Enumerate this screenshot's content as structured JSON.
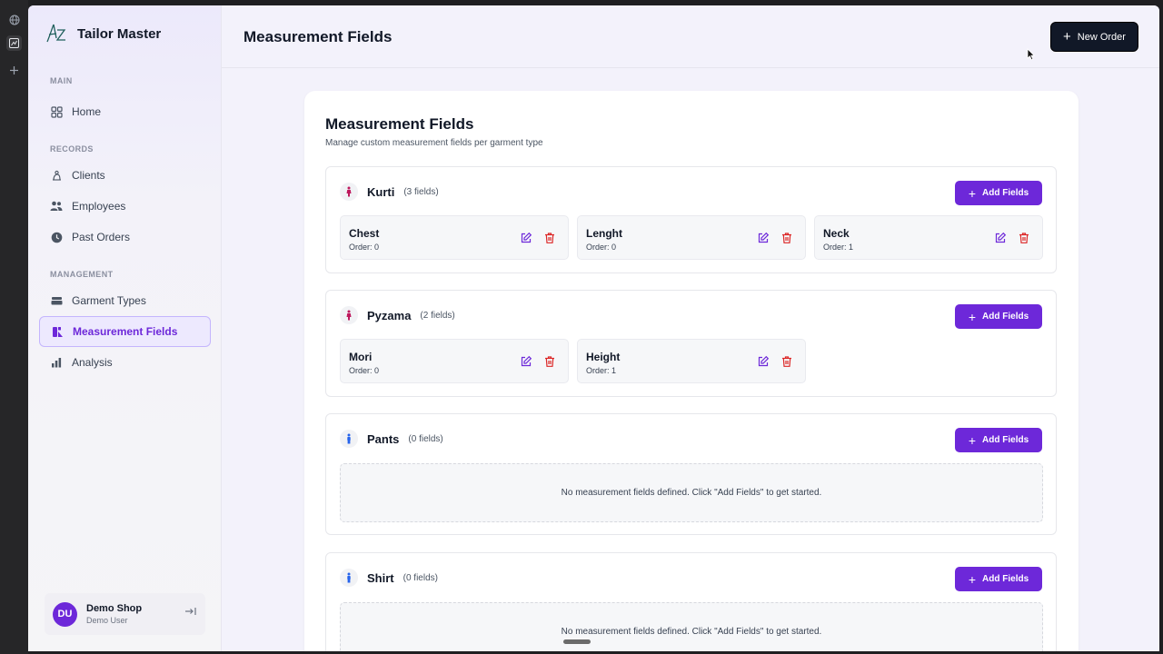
{
  "app": {
    "brand_name": "Tailor Master",
    "page_title": "Measurement Fields",
    "new_order_label": "New Order"
  },
  "sidebar": {
    "sections": {
      "main": "MAIN",
      "records": "RECORDS",
      "management": "MANAGEMENT"
    },
    "items": [
      {
        "label": "Home",
        "icon": "grid-icon"
      },
      {
        "label": "Clients",
        "icon": "scissors-icon"
      },
      {
        "label": "Employees",
        "icon": "users-icon"
      },
      {
        "label": "Past Orders",
        "icon": "clock-icon"
      },
      {
        "label": "Garment Types",
        "icon": "layers-icon"
      },
      {
        "label": "Measurement Fields",
        "icon": "ruler-icon",
        "active": true
      },
      {
        "label": "Analysis",
        "icon": "bar-chart-icon"
      }
    ],
    "user": {
      "initials": "DU",
      "name": "Demo Shop",
      "role": "Demo User"
    }
  },
  "main": {
    "title": "Measurement Fields",
    "subtitle": "Manage custom measurement fields per garment type",
    "add_label": "Add Fields",
    "empty_message": "No measurement fields defined. Click \"Add Fields\" to get started.",
    "garments": [
      {
        "name": "Kurti",
        "count": "(3 fields)",
        "icon_color": "#be185d",
        "fields": [
          {
            "name": "Chest",
            "order": "Order: 0"
          },
          {
            "name": "Lenght",
            "order": "Order: 0"
          },
          {
            "name": "Neck",
            "order": "Order: 1"
          }
        ]
      },
      {
        "name": "Pyzama",
        "count": "(2 fields)",
        "icon_color": "#be185d",
        "fields": [
          {
            "name": "Mori",
            "order": "Order: 0"
          },
          {
            "name": "Height",
            "order": "Order: 1"
          }
        ]
      },
      {
        "name": "Pants",
        "count": "(0 fields)",
        "icon_color": "#2563eb",
        "fields": []
      },
      {
        "name": "Shirt",
        "count": "(0 fields)",
        "icon_color": "#2563eb",
        "fields": []
      }
    ]
  },
  "colors": {
    "accent": "#6d28d9",
    "danger": "#dc2626",
    "dark_button": "#111827"
  }
}
